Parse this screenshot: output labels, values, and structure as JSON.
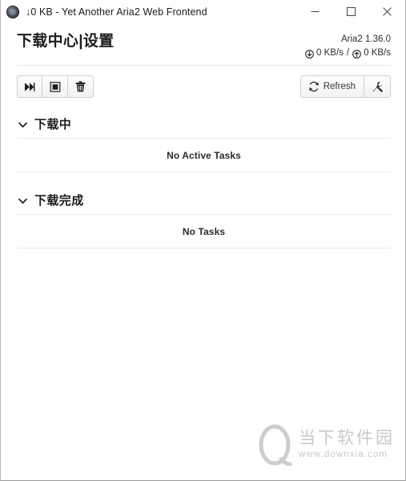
{
  "window": {
    "title": "↓0 KB - Yet Another Aria2 Web Frontend",
    "app_icon": "aria2-app-icon",
    "controls": {
      "minimize": "minimize-icon",
      "maximize": "maximize-icon",
      "close": "close-icon"
    }
  },
  "header": {
    "title_primary": "下载中心",
    "title_separator": "|",
    "title_secondary": "设置",
    "aria2_version": "Aria2 1.36.0",
    "download_speed": "0 KB/s",
    "speed_divider": "/",
    "upload_speed": "0 KB/s",
    "download_icon": "download-speed-icon",
    "upload_icon": "upload-speed-icon"
  },
  "toolbar": {
    "resume_all_label": "",
    "resume_all_icon": "fast-forward-icon",
    "pause_all_label": "",
    "pause_all_icon": "stop-icon",
    "delete_label": "",
    "delete_icon": "trash-icon",
    "refresh_label": "Refresh",
    "refresh_icon": "refresh-icon",
    "settings_label": "",
    "settings_icon": "wrench-icon"
  },
  "sections": [
    {
      "id": "downloading",
      "title": "下载中",
      "chevron": "chevron-down-icon",
      "empty_text": "No Active Tasks"
    },
    {
      "id": "completed",
      "title": "下载完成",
      "chevron": "chevron-down-icon",
      "empty_text": "No Tasks"
    }
  ],
  "watermark": {
    "name": "当下软件园",
    "url": "www.downxia.com",
    "logo": "downxia-logo-icon"
  },
  "colors": {
    "text_primary": "#1d1d1d",
    "text_secondary": "#2e2e2e",
    "border": "#e8e8e8",
    "watermark": "#c9c9c9",
    "window_border": "#b8b8b8"
  }
}
